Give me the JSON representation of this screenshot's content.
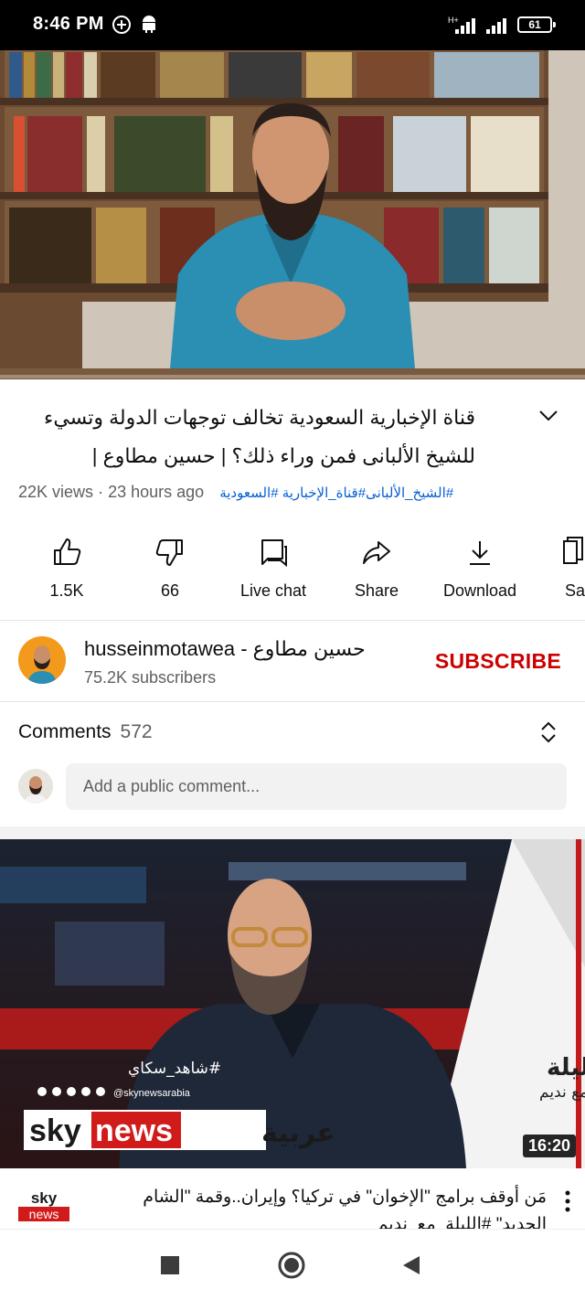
{
  "status_bar": {
    "time": "8:46 PM",
    "battery": "61",
    "icons": [
      "add-circle-icon",
      "android-icon",
      "signal-icon",
      "signal-icon",
      "battery-icon"
    ]
  },
  "video": {
    "title": "قناة الإخبارية السعودية تخالف توجهات الدولة وتسيء للشيخ الألبانى فمن وراء ذلك؟ | حسين مطاوع |",
    "views": "22K views",
    "separator": "·",
    "time_ago": "23 hours ago",
    "hashtags": "#الشيخ_الألبانى#قناة_الإخبارية #السعودية",
    "progress": 0.0
  },
  "actions": [
    {
      "id": "like",
      "label": "1.5K",
      "icon": "thumbs-up-icon"
    },
    {
      "id": "dislike",
      "label": "66",
      "icon": "thumbs-down-icon"
    },
    {
      "id": "live-chat",
      "label": "Live chat",
      "icon": "live-chat-icon"
    },
    {
      "id": "share",
      "label": "Share",
      "icon": "share-icon"
    },
    {
      "id": "download",
      "label": "Download",
      "icon": "download-icon"
    },
    {
      "id": "save",
      "label": "Sa",
      "icon": "save-icon"
    }
  ],
  "channel": {
    "name": "husseinmotawea - حسين مطاوع",
    "subscribers": "75.2K subscribers",
    "subscribe_label": "SUBSCRIBE"
  },
  "comments": {
    "label": "Comments",
    "count": "572",
    "placeholder": "Add a public comment..."
  },
  "next_video": {
    "duration": "16:20",
    "title": "مَن أوقف برامج \"الإخوان\" في تركيا؟ وإيران..وقمة \"الشام الجديد\" #الليلة_مع_نديم",
    "overlay_hashtag": "#شاهد_سكاي",
    "overlay_handle": "@skynewsarabia",
    "overlay_show": "الليلة",
    "overlay_show_sub": "مع نديم",
    "logo_sky": "sky",
    "logo_news": "news",
    "logo_arabia": "عربية",
    "channel_logo_sky": "sky",
    "channel_logo_news": "news"
  },
  "colors": {
    "subscribe": "#cc0000",
    "hashtag": "#065fd4",
    "secondary_text": "#606060",
    "progress": "#ff0000"
  }
}
